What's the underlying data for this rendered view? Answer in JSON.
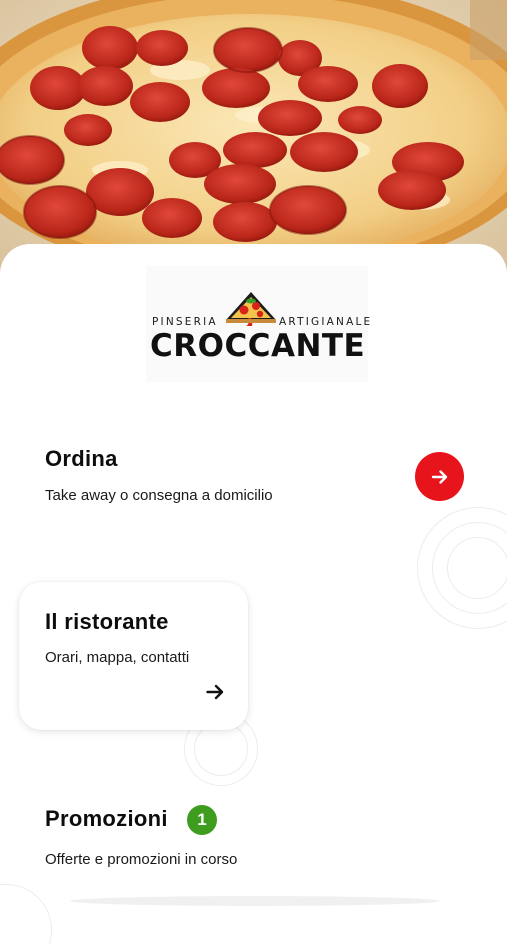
{
  "brand": {
    "top_left": "PINSERIA",
    "top_right": "ARTIGIANALE",
    "name": "CROCCANTE",
    "accent": "#e8141c"
  },
  "sections": {
    "order": {
      "title": "Ordina",
      "subtitle": "Take away o consegna a domicilio",
      "arrow_icon": "arrow-right-icon"
    },
    "restaurant": {
      "title": "Il ristorante",
      "subtitle": "Orari, mappa, contatti",
      "arrow_icon": "arrow-right-icon"
    },
    "promotions": {
      "title": "Promozioni",
      "count": "1",
      "subtitle": "Offerte e promozioni in corso",
      "badge_color": "#3e9c1e"
    }
  },
  "hero": {
    "image": "pepperoni-pizza-photo"
  }
}
